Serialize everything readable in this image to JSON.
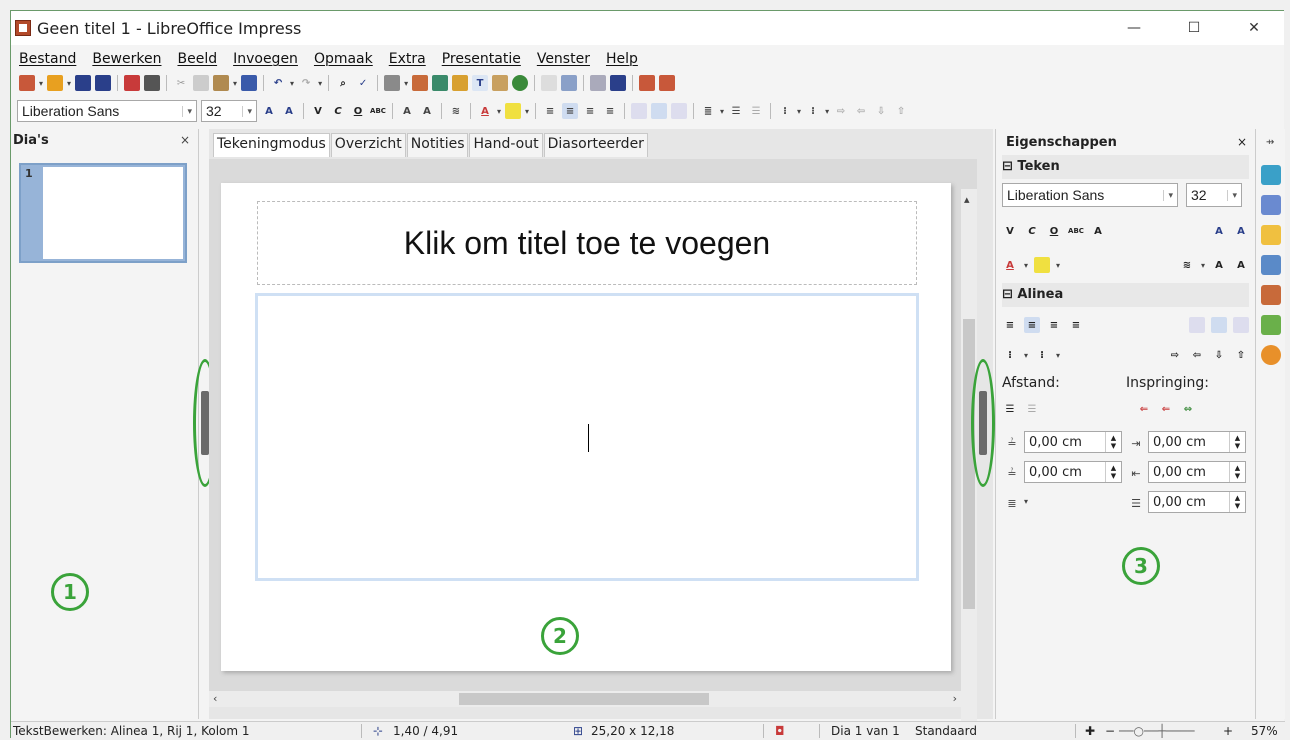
{
  "window": {
    "title": "Geen titel 1 - LibreOffice Impress",
    "controls": {
      "minimize": "—",
      "maximize": "☐",
      "close": "✕"
    }
  },
  "menu": [
    "Bestand",
    "Bewerken",
    "Beeld",
    "Invoegen",
    "Opmaak",
    "Extra",
    "Presentatie",
    "Venster",
    "Help"
  ],
  "toolbar": {
    "font_name": "Liberation Sans",
    "font_size": "32"
  },
  "slides_pane": {
    "title": "Dia's",
    "close": "×",
    "thumbnail_number": "1"
  },
  "annotations": [
    "1",
    "2",
    "3"
  ],
  "view_tabs": [
    "Tekeningmodus",
    "Overzicht",
    "Notities",
    "Hand-out",
    "Diasorteerder"
  ],
  "slide": {
    "title_placeholder": "Klik om titel toe te voegen"
  },
  "properties": {
    "title": "Eigenschappen",
    "close": "×",
    "character_section": "Teken",
    "font_name": "Liberation Sans",
    "font_size": "32",
    "paragraph_section": "Alinea",
    "spacing_label": "Afstand:",
    "indent_label": "Inspringing:",
    "above_spacing": "0,00 cm",
    "below_spacing": "0,00 cm",
    "before_indent": "0,00 cm",
    "after_indent": "0,00 cm",
    "first_line_indent": "0,00 cm"
  },
  "statusbar": {
    "edit_status": "TekstBewerken: Alinea 1, Rij 1, Kolom 1",
    "position": "1,40 / 4,91",
    "size": "25,20 x 12,18",
    "slide_info": "Dia 1 van 1",
    "master": "Standaard",
    "zoom": "57%"
  }
}
